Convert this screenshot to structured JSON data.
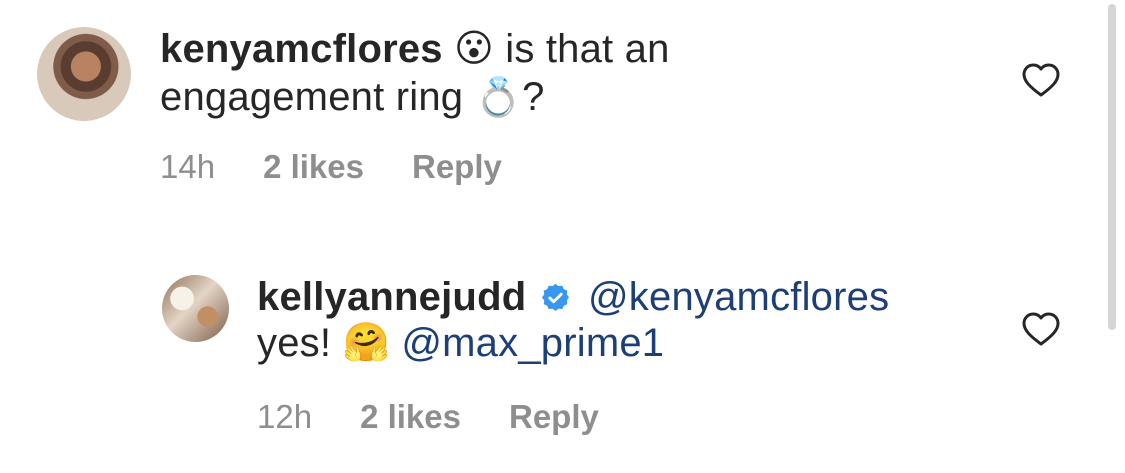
{
  "comments": [
    {
      "username": "kenyamcflores",
      "text_line_1": "is that an",
      "text_line_2": "engagement ring",
      "text_end": "?",
      "emojis": {
        "first": "😮",
        "second": "💍"
      },
      "time": "14h",
      "likes": "2 likes",
      "reply_label": "Reply",
      "icon": "heart-icon"
    },
    {
      "username": "kellyannejudd",
      "mention_1": "@kenyamcflores",
      "text_line_2": "yes!",
      "mention_2": "@max_prime1",
      "emoji": "🤗",
      "time": "12h",
      "likes": "2 likes",
      "reply_label": "Reply",
      "verified_icon": "verified-badge-icon",
      "icon": "heart-icon"
    }
  ],
  "colors": {
    "username": "#262626",
    "meta": "#8e8e8e",
    "mention": "#1d3f77",
    "verified": "#3897f0"
  }
}
